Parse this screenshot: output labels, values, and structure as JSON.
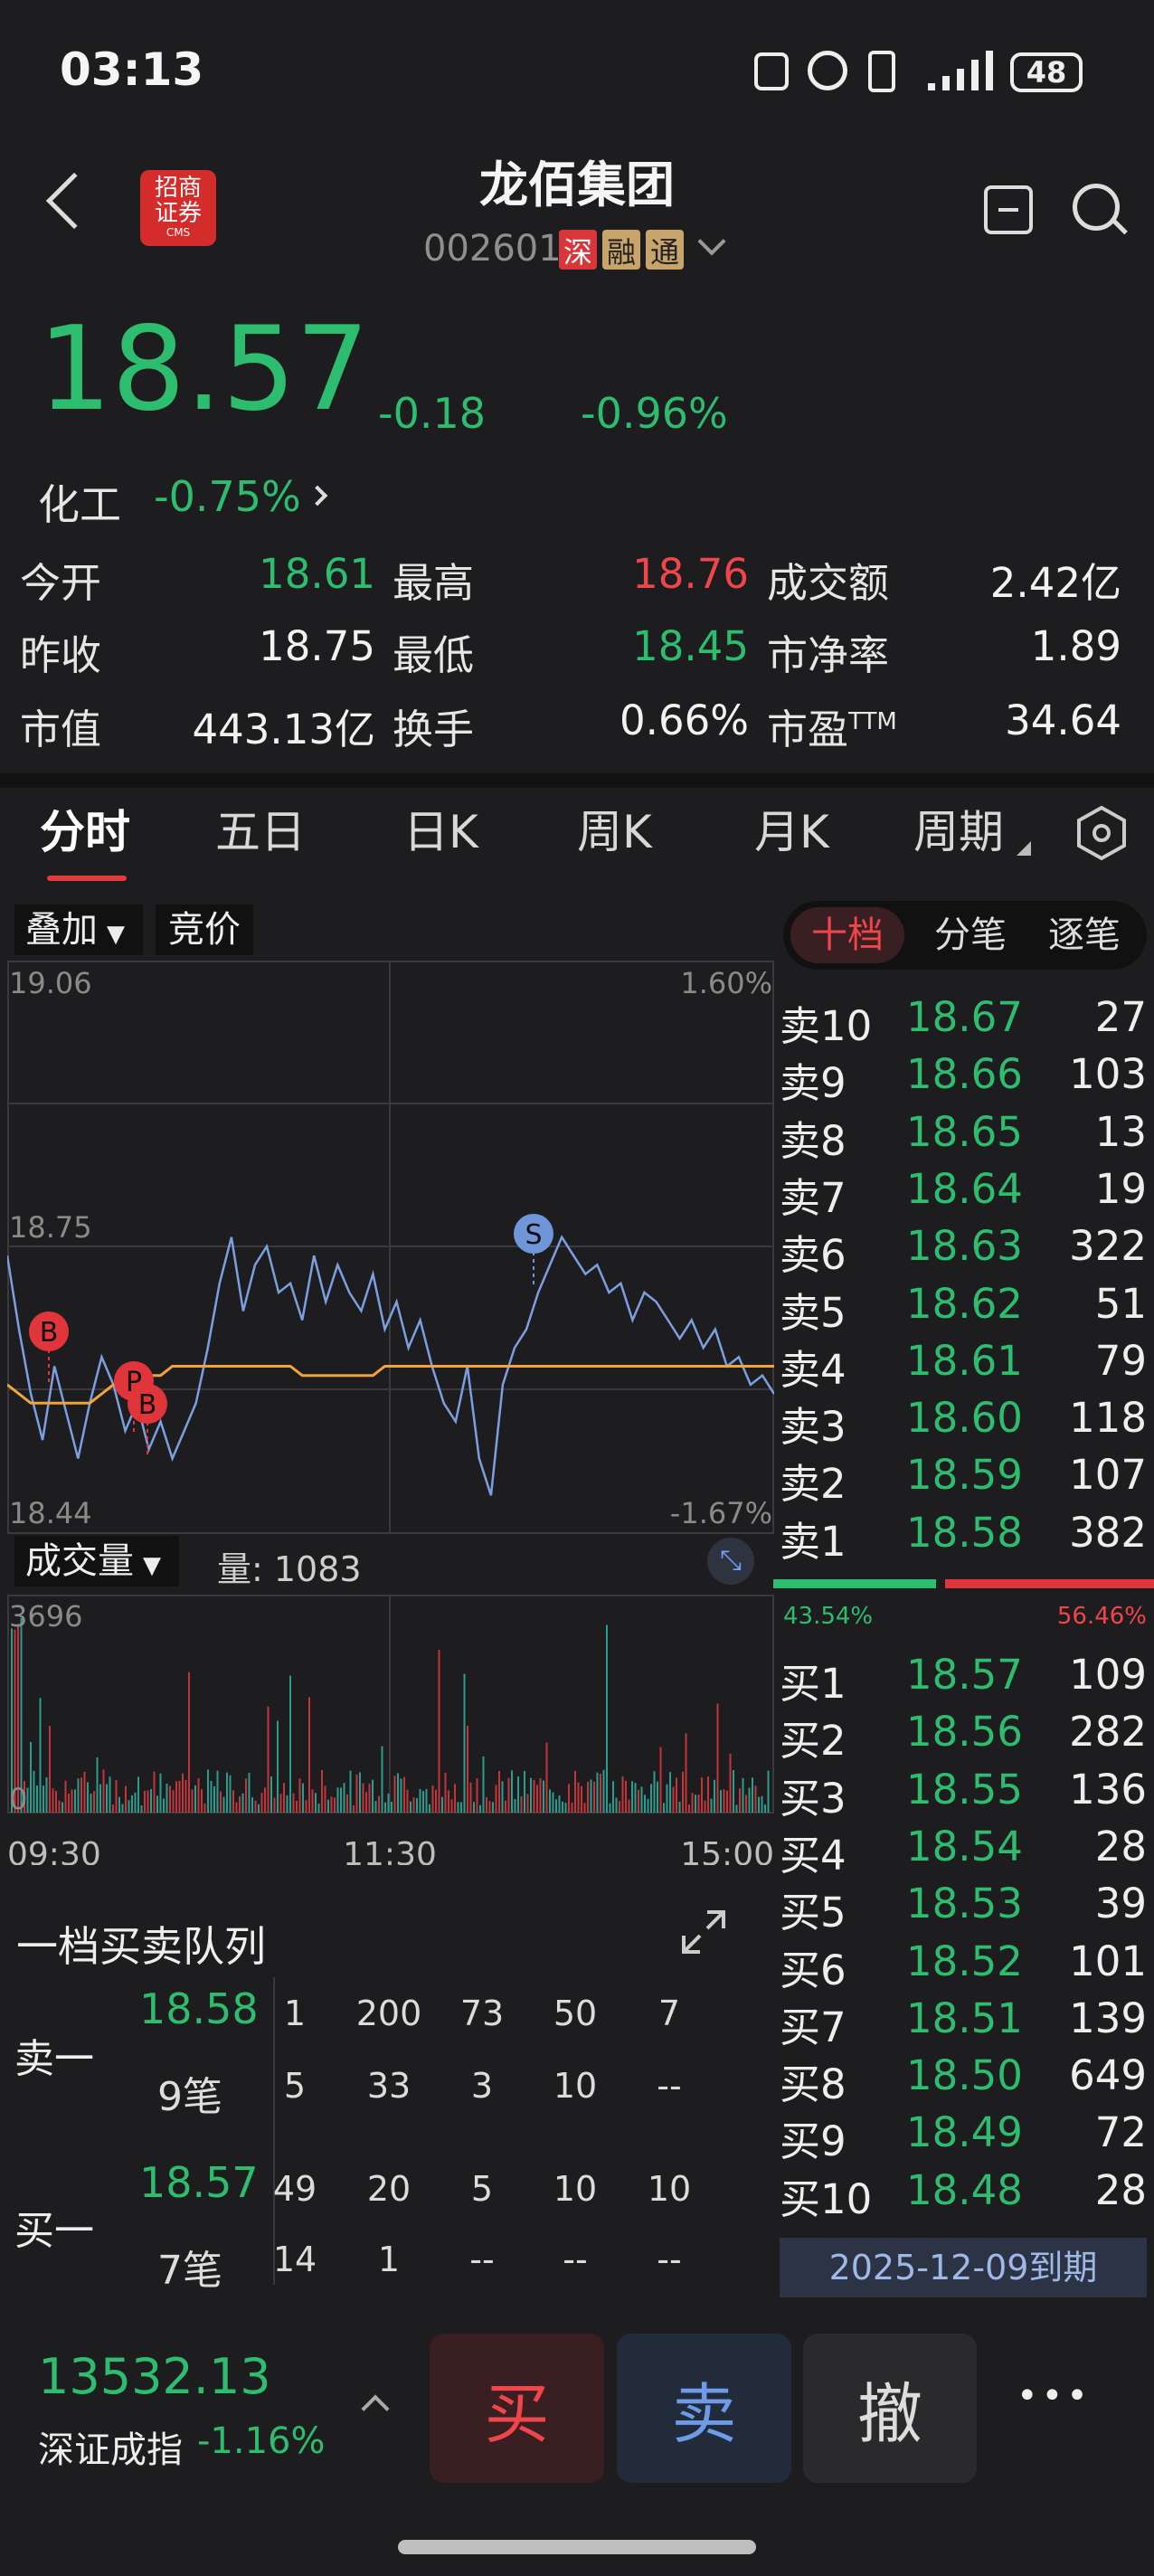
{
  "status": {
    "time": "03:13",
    "battery": "48"
  },
  "header": {
    "title": "龙佰集团",
    "code": "002601",
    "badges": [
      "深",
      "融",
      "通"
    ],
    "broker_logo": "招商证券",
    "broker_sub": "CMS"
  },
  "price": {
    "last": "18.57",
    "change": "-0.18",
    "pct": "-0.96%",
    "sector": "化工",
    "sector_pct": "-0.75%"
  },
  "stats": {
    "open_l": "今开",
    "open": "18.61",
    "high_l": "最高",
    "high": "18.76",
    "amt_l": "成交额",
    "amt": "2.42亿",
    "prev_l": "昨收",
    "prev": "18.75",
    "low_l": "最低",
    "low": "18.45",
    "pb_l": "市净率",
    "pb": "1.89",
    "cap_l": "市值",
    "cap": "443.13亿",
    "turn_l": "换手",
    "turn": "0.66%",
    "pe_l": "市盈",
    "pe_sup": "TTM",
    "pe": "34.64"
  },
  "tabs": [
    "分时",
    "五日",
    "日K",
    "周K",
    "月K",
    "周期"
  ],
  "chart_controls": {
    "overlay": "叠加",
    "auction": "竞价",
    "volume": "成交量",
    "vol_label": "量: 1083"
  },
  "chart_data": {
    "type": "line",
    "ylim": [
      18.44,
      19.06
    ],
    "y_ticks": [
      "19.06",
      "18.75",
      "18.44"
    ],
    "pct_ticks": [
      "1.60%",
      "-1.67%"
    ],
    "x_ticks": [
      "09:30",
      "11:30",
      "15:00"
    ],
    "vol_max": "3696",
    "vol_min": "0",
    "prev_close": 18.75,
    "series": [
      {
        "color": "#7b9fe0",
        "values": [
          18.74,
          18.66,
          18.59,
          18.54,
          18.62,
          18.57,
          18.52,
          18.58,
          18.63,
          18.6,
          18.55,
          18.58,
          18.53,
          18.56,
          18.52,
          18.55,
          18.58,
          18.64,
          18.71,
          18.76,
          18.68,
          18.73,
          18.75,
          18.7,
          18.71,
          18.67,
          18.74,
          18.69,
          18.73,
          18.7,
          18.68,
          18.72,
          18.66,
          18.69,
          18.64,
          18.67,
          18.62,
          18.58,
          18.56,
          18.62,
          18.52,
          18.48,
          18.6,
          18.64,
          18.66,
          18.7,
          18.73,
          18.76,
          18.74,
          18.72,
          18.73,
          18.7,
          18.71,
          18.67,
          18.7,
          18.69,
          18.67,
          18.65,
          18.67,
          18.64,
          18.66,
          18.62,
          18.63,
          18.6,
          18.61,
          18.59
        ]
      },
      {
        "color": "#f2a43a",
        "values": [
          18.6,
          18.59,
          18.58,
          18.58,
          18.58,
          18.58,
          18.58,
          18.58,
          18.59,
          18.6,
          18.6,
          18.61,
          18.61,
          18.61,
          18.62,
          18.62,
          18.62,
          18.62,
          18.62,
          18.62,
          18.62,
          18.62,
          18.62,
          18.62,
          18.62,
          18.61,
          18.61,
          18.61,
          18.61,
          18.61,
          18.61,
          18.61,
          18.62,
          18.62,
          18.62,
          18.62,
          18.62,
          18.62,
          18.62,
          18.62,
          18.62,
          18.62,
          18.62,
          18.62,
          18.62,
          18.62,
          18.62,
          18.62,
          18.62,
          18.62,
          18.62,
          18.62,
          18.62,
          18.62,
          18.62,
          18.62,
          18.62,
          18.62,
          18.62,
          18.62,
          18.62,
          18.62,
          18.62,
          18.62,
          18.62,
          18.62
        ]
      }
    ],
    "markers": [
      "B",
      "P",
      "B",
      "S"
    ]
  },
  "orderbook": {
    "tabs": [
      "十档",
      "分笔",
      "逐笔"
    ],
    "asks": [
      [
        "卖10",
        "18.67",
        "27"
      ],
      [
        "卖9",
        "18.66",
        "103"
      ],
      [
        "卖8",
        "18.65",
        "13"
      ],
      [
        "卖7",
        "18.64",
        "19"
      ],
      [
        "卖6",
        "18.63",
        "322"
      ],
      [
        "卖5",
        "18.62",
        "51"
      ],
      [
        "卖4",
        "18.61",
        "79"
      ],
      [
        "卖3",
        "18.60",
        "118"
      ],
      [
        "卖2",
        "18.59",
        "107"
      ],
      [
        "卖1",
        "18.58",
        "382"
      ]
    ],
    "buy_pct": "43.54%",
    "sell_pct": "56.46%",
    "bids": [
      [
        "买1",
        "18.57",
        "109"
      ],
      [
        "买2",
        "18.56",
        "282"
      ],
      [
        "买3",
        "18.55",
        "136"
      ],
      [
        "买4",
        "18.54",
        "28"
      ],
      [
        "买5",
        "18.53",
        "39"
      ],
      [
        "买6",
        "18.52",
        "101"
      ],
      [
        "买7",
        "18.51",
        "139"
      ],
      [
        "买8",
        "18.50",
        "649"
      ],
      [
        "买9",
        "18.49",
        "72"
      ],
      [
        "买10",
        "18.48",
        "28"
      ]
    ],
    "expiry": "2025-12-09到期"
  },
  "queue": {
    "title": "一档买卖队列",
    "sell_label": "卖一",
    "sell_price": "18.58",
    "sell_count": "9笔",
    "sell_rows": [
      [
        "1",
        "200",
        "73",
        "50",
        "7"
      ],
      [
        "5",
        "33",
        "3",
        "10",
        "--"
      ]
    ],
    "buy_label": "买一",
    "buy_price": "18.57",
    "buy_count": "7笔",
    "buy_rows": [
      [
        "49",
        "20",
        "5",
        "10",
        "10"
      ],
      [
        "14",
        "1",
        "--",
        "--",
        "--"
      ]
    ]
  },
  "footer": {
    "index_value": "13532.13",
    "index_name": "深证成指",
    "index_pct": "-1.16%",
    "buy": "买",
    "sell": "卖",
    "cancel": "撤",
    "more": "•••"
  }
}
